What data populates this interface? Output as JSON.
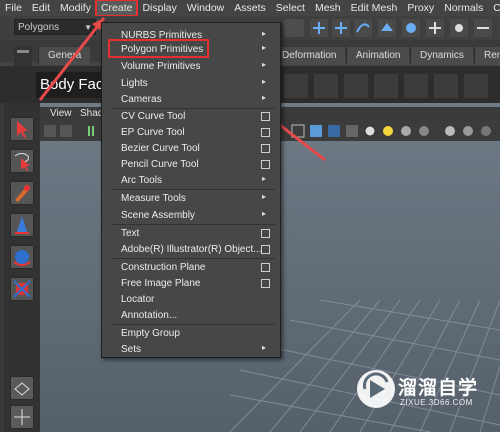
{
  "menubar": [
    "File",
    "Edit",
    "Modify",
    "Create",
    "Display",
    "Window",
    "Assets",
    "Select",
    "Mesh",
    "Edit Mesh",
    "Proxy",
    "Normals",
    "Color"
  ],
  "menuset": "Polygons",
  "shelf_tabs": [
    "Genera",
    "Deformation",
    "Animation",
    "Dynamics",
    "Rende"
  ],
  "shelf_label": "Body Face",
  "viewport_menu": [
    "View",
    "Shad"
  ],
  "create_menu": {
    "items": [
      {
        "label": "NURBS Primitives",
        "kind": "submenu"
      },
      {
        "label": "Polygon Primitives",
        "kind": "submenu",
        "highlighted": true
      },
      {
        "label": "Volume Primitives",
        "kind": "submenu"
      },
      {
        "label": "Lights",
        "kind": "submenu"
      },
      {
        "label": "Cameras",
        "kind": "submenu"
      },
      {
        "label": "CV Curve Tool",
        "kind": "option"
      },
      {
        "label": "EP Curve Tool",
        "kind": "option"
      },
      {
        "label": "Bezier Curve Tool",
        "kind": "option"
      },
      {
        "label": "Pencil Curve Tool",
        "kind": "option"
      },
      {
        "label": "Arc Tools",
        "kind": "submenu"
      },
      {
        "label": "Measure Tools",
        "kind": "submenu"
      },
      {
        "label": "Scene Assembly",
        "kind": "submenu"
      },
      {
        "label": "Text",
        "kind": "option"
      },
      {
        "label": "Adobe(R) Illustrator(R) Object...",
        "kind": "option"
      },
      {
        "label": "Construction Plane",
        "kind": "option"
      },
      {
        "label": "Free Image Plane",
        "kind": "option"
      },
      {
        "label": "Locator",
        "kind": "plain"
      },
      {
        "label": "Annotation...",
        "kind": "plain"
      },
      {
        "label": "Empty Group",
        "kind": "plain"
      },
      {
        "label": "Sets",
        "kind": "submenu"
      }
    ]
  },
  "watermark": {
    "title": "溜溜自学",
    "url": "ZIXUE.3D66.COM"
  },
  "colors": {
    "highlight_red": "#e53030",
    "menu_bg": "#474747",
    "accent_blue": "#2a6fd6"
  }
}
